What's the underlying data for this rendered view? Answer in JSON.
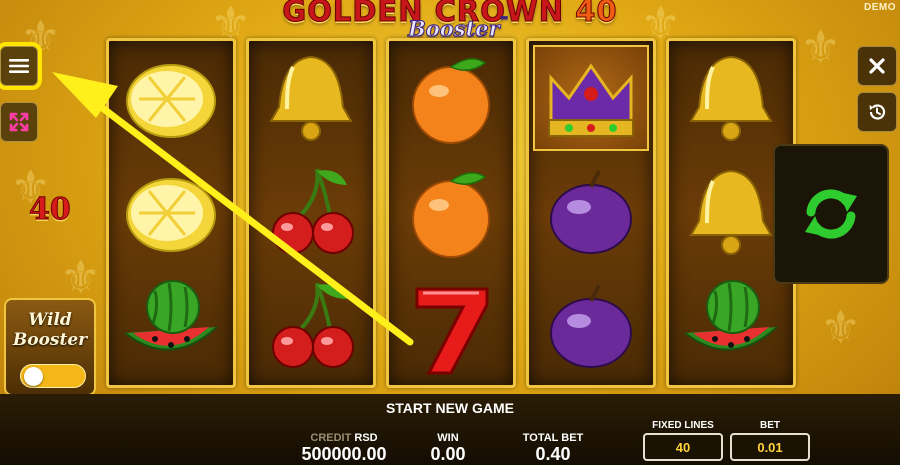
{
  "game": {
    "title_main": "GOLDEN CROWN ",
    "title_num": "40",
    "title_sub": "Booster",
    "title_tm": "™",
    "mode_label": "DEMO"
  },
  "reels": [
    [
      "lemon",
      "lemon",
      "watermelon"
    ],
    [
      "bell",
      "cherries",
      "cherries"
    ],
    [
      "orange",
      "orange",
      "seven"
    ],
    [
      "crown",
      "plum",
      "plum"
    ],
    [
      "bell",
      "bell",
      "watermelon"
    ]
  ],
  "left_panel": {
    "menu_icon": "hamburger-menu-icon",
    "fullscreen_icon": "fullscreen-arrows-icon",
    "lines_badge": "40",
    "wild_booster_line1": "Wild",
    "wild_booster_line2": "Booster",
    "wild_booster_enabled": false
  },
  "right_panel": {
    "close_icon": "close-icon",
    "history_icon": "history-icon",
    "spin_icon": "spin-refresh-icon"
  },
  "bottom_bar": {
    "start_label": "START NEW GAME",
    "credit_label_dim": "CREDIT",
    "credit_label_currency": "RSD",
    "credit_value": "500000.00",
    "win_label": "WIN",
    "win_value": "0.00",
    "total_bet_label": "TOTAL BET",
    "total_bet_value": "0.40",
    "fixed_lines_label": "FIXED LINES",
    "fixed_lines_value": "40",
    "bet_label": "BET",
    "bet_value": "0.01"
  },
  "colors": {
    "accent_yellow": "#ffe500",
    "spin_green": "#2ecc2e",
    "frame_gold": "#f0c640"
  }
}
